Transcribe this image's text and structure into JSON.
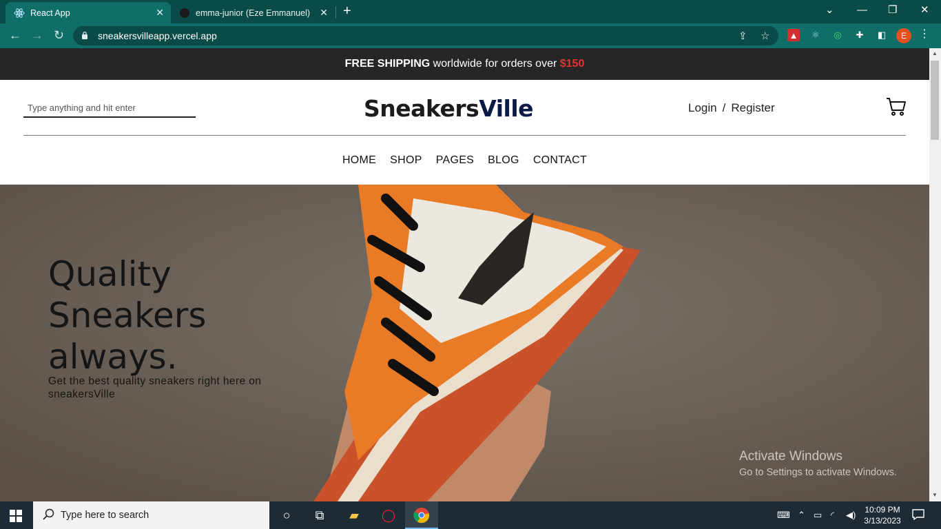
{
  "browser": {
    "tabs": [
      {
        "title": "React App",
        "active": true
      },
      {
        "title": "emma-junior (Eze Emmanuel)",
        "active": false
      }
    ],
    "url": "sneakersvilleapp.vercel.app",
    "profile_initial": "E"
  },
  "site": {
    "promo": {
      "bold": "FREE SHIPPING",
      "text": " worldwide for orders over ",
      "price": "$150"
    },
    "search": {
      "placeholder": "Type anything and hit enter"
    },
    "logo": {
      "part1": "Sneakers",
      "part2": "Ville"
    },
    "auth": {
      "login": "Login",
      "sep": "/",
      "register": "Register"
    },
    "nav": [
      "HOME",
      "SHOP",
      "PAGES",
      "BLOG",
      "CONTACT"
    ],
    "hero": {
      "title_line1": "Quality",
      "title_line2": "Sneakers",
      "title_line3": "always.",
      "subtitle": "Get the best quality sneakers right here on sneakersVille"
    },
    "watermark": {
      "line1": "Activate Windows",
      "line2": "Go to Settings to activate Windows."
    }
  },
  "taskbar": {
    "search_placeholder": "Type here to search",
    "time": "10:09 PM",
    "date": "3/13/2023"
  },
  "colors": {
    "chrome_dark": "#0b4b47",
    "chrome_light": "#0f6e68",
    "promo_bg": "#262626",
    "price_red": "#e53232",
    "logo_navy": "#0a1a45",
    "taskbar": "#1d2b37"
  }
}
